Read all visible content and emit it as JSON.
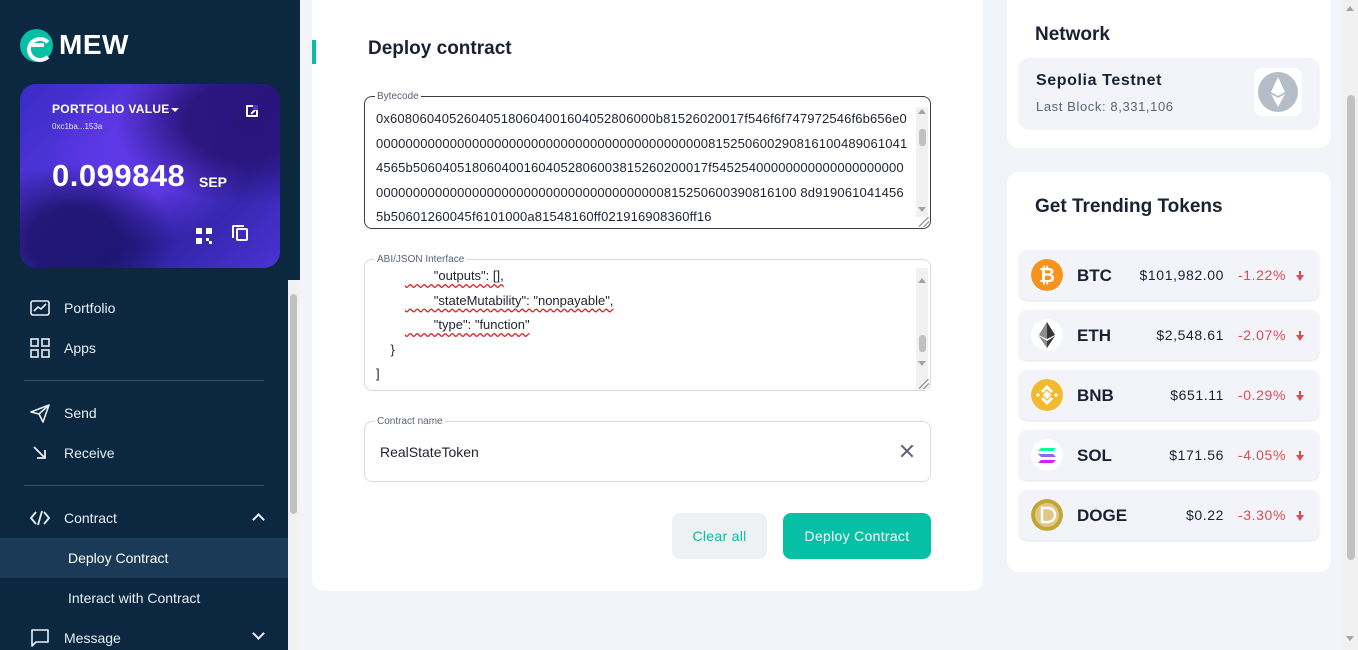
{
  "app": {
    "name": "MEW"
  },
  "wallet_card": {
    "label": "PORTFOLIO VALUE",
    "address": "0xc1ba...153a",
    "balance": "0.099848",
    "unit": "SEP"
  },
  "sidebar": {
    "items": [
      {
        "label": "Portfolio",
        "icon": "chart-icon"
      },
      {
        "label": "Apps",
        "icon": "grid-icon"
      },
      {
        "label": "Send",
        "icon": "send-icon"
      },
      {
        "label": "Receive",
        "icon": "receive-arrow-icon"
      },
      {
        "label": "Contract",
        "icon": "code-icon"
      },
      {
        "label": "Message",
        "icon": "message-icon"
      }
    ],
    "contract_sub": [
      {
        "label": "Deploy Contract",
        "active": true
      },
      {
        "label": "Interact with Contract",
        "active": false
      }
    ]
  },
  "deploy": {
    "title": "Deploy contract",
    "bytecode_label": "Bytecode",
    "bytecode_value": "0x608060405260405180604001604052806000b81526020017f546f6f747972546f6b656e00000000000000000000000000000000000000000000008152506002908161004890610414565b5060405180604001604052806003815260200017f54525400000000000000000000000000000000000000000000000000000000000815250600390816100 8d9190610414565b50601260045f6101000a81548160ff021916908360ff16",
    "abi_label": "ABI/JSON Interface",
    "abi_lines": [
      "        \"outputs\": [],",
      "        \"stateMutability\": \"nonpayable\",",
      "        \"type\": \"function\"",
      "    }",
      "]"
    ],
    "contract_name_label": "Contract name",
    "contract_name_value": "RealStateToken",
    "clear_label": "Clear all",
    "deploy_label": "Deploy Contract"
  },
  "network": {
    "title": "Network",
    "name": "Sepolia Testnet",
    "last_block": "Last Block: 8,331,106"
  },
  "trending": {
    "title": "Get Trending Tokens",
    "tokens": [
      {
        "symbol": "BTC",
        "price": "$101,982.00",
        "change": "-1.22%",
        "color": "#f7931a"
      },
      {
        "symbol": "ETH",
        "price": "$2,548.61",
        "change": "-2.07%",
        "color": "#ffffff"
      },
      {
        "symbol": "BNB",
        "price": "$651.11",
        "change": "-0.29%",
        "color": "#f3ba2f"
      },
      {
        "symbol": "SOL",
        "price": "$171.56",
        "change": "-4.05%",
        "color": "#ffffff"
      },
      {
        "symbol": "DOGE",
        "price": "$0.22",
        "change": "-3.30%",
        "color": "#c2a633"
      }
    ]
  }
}
